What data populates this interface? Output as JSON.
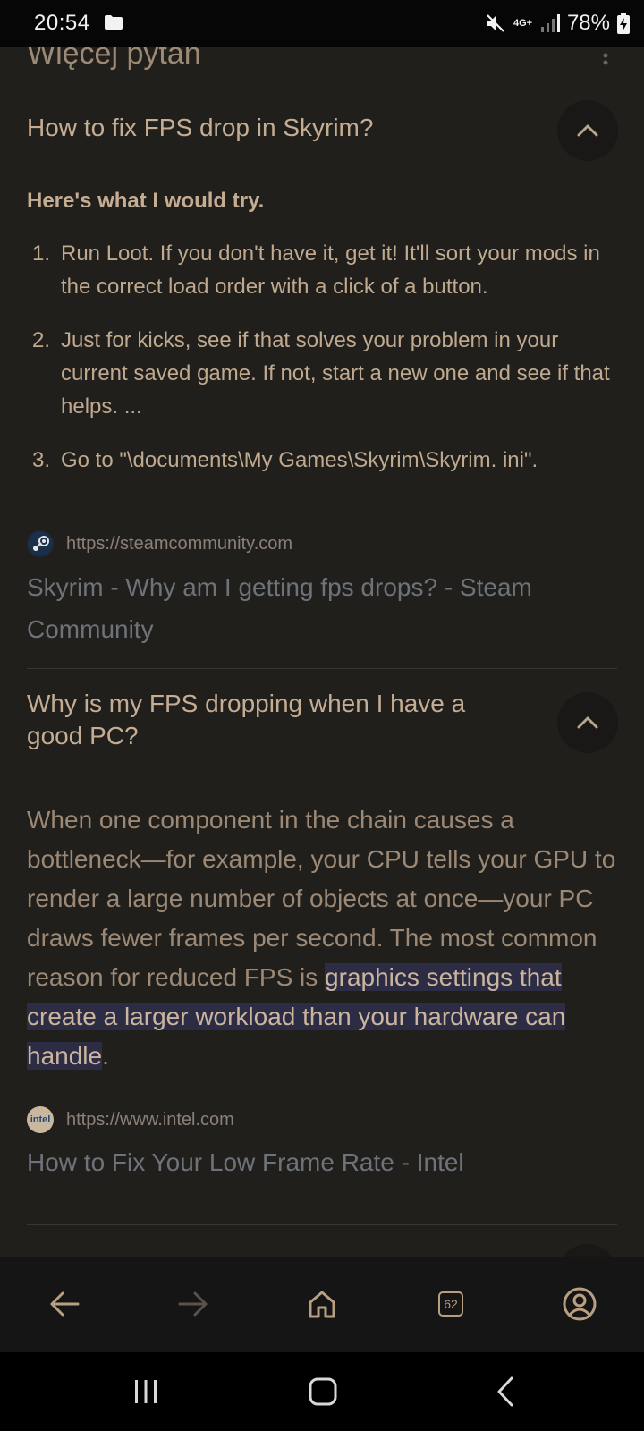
{
  "status": {
    "time": "20:54",
    "network": "4G+",
    "battery": "78%",
    "icons": [
      "folder-icon",
      "mute-icon",
      "signal-icon",
      "battery-icon"
    ]
  },
  "section": {
    "title": "Więcej pytań"
  },
  "faqs": [
    {
      "question": "How to fix FPS drop in Skyrim?",
      "lead": "Here's what I would try.",
      "steps": [
        "Run Loot. If you don't have it, get it! It'll sort your mods in the correct load order with a click of a button.",
        "Just for kicks, see if that solves your problem in your current saved game. If not, start a new one and see if that helps. ...",
        "Go to \"\\documents\\My Games\\Skyrim\\Skyrim. ini\"."
      ],
      "source_url": "https://steamcommunity.com",
      "source_title": "Skyrim - Why am I getting fps drops? - Steam Community"
    },
    {
      "question": "Why is my FPS dropping when I have a good PC?",
      "answer_plain": "When one component in the chain causes a bottleneck—for example, your CPU tells your GPU to render a large number of objects at once—your PC draws fewer frames per second. The most common reason for reduced FPS is ",
      "answer_highlight": "graphics settings that create a larger workload than your hardware can handle",
      "answer_end": ".",
      "source_url": "https://www.intel.com",
      "source_favicon_text": "intel",
      "source_title": "How to Fix Your Low Frame Rate - Intel"
    }
  ],
  "toolbar": {
    "tab_count": "62",
    "icons": [
      "back-arrow-icon",
      "forward-arrow-icon",
      "home-icon",
      "tabs-icon",
      "account-icon"
    ]
  },
  "colors": {
    "background": "#211f1c",
    "text_accent": "#c4ad93",
    "link": "#6e737a",
    "highlight": "#2c2d45"
  }
}
